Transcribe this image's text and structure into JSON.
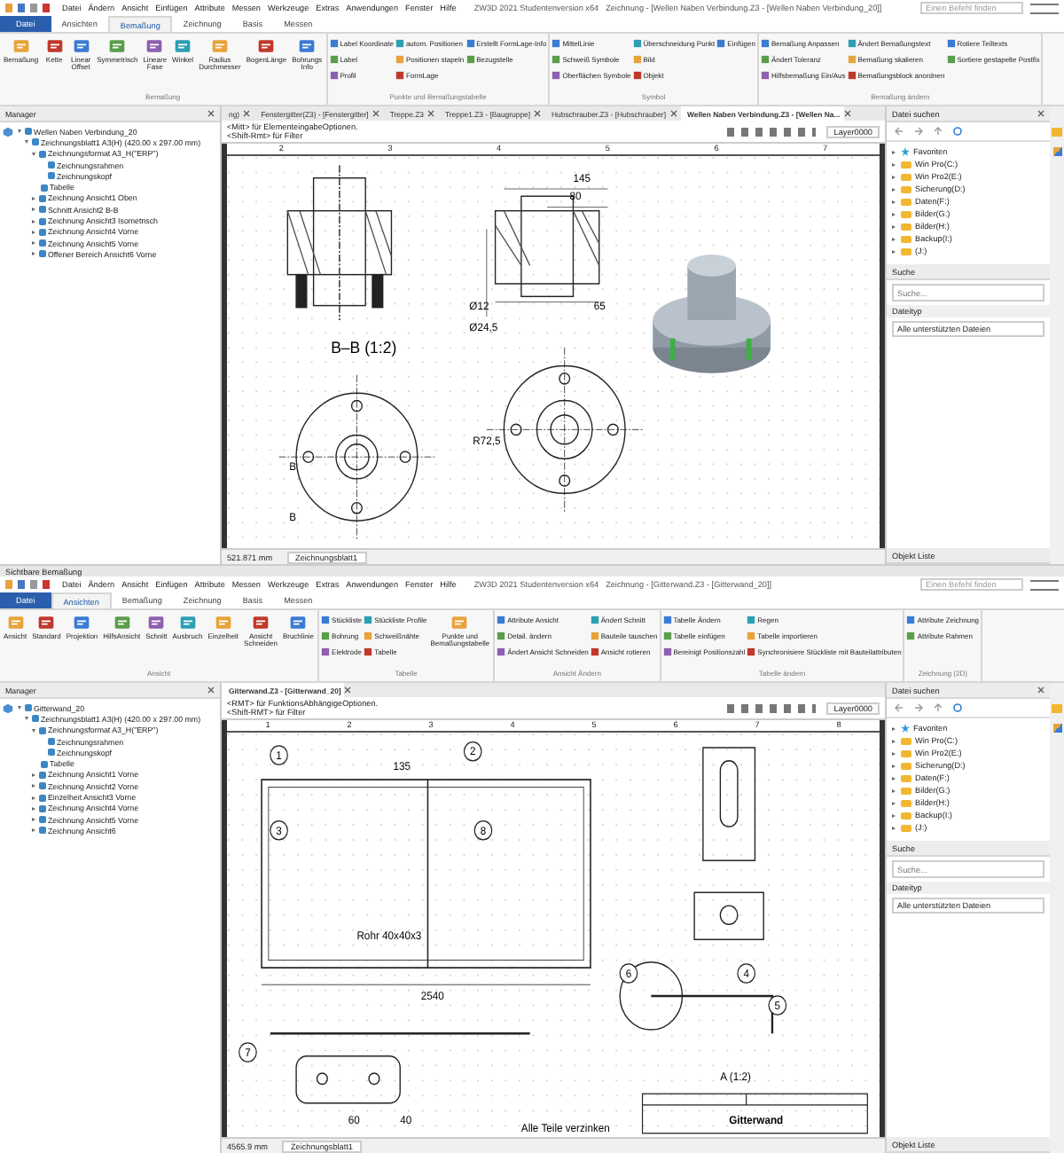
{
  "windows": [
    {
      "quick_menu": [
        "Datei",
        "Ändern",
        "Ansicht",
        "Einfügen",
        "Attribute",
        "Messen",
        "Werkzeuge",
        "Extras",
        "Anwendungen",
        "Fenster",
        "Hilfe"
      ],
      "app_title": "ZW3D  2021 Studentenversion x64",
      "doc_title": "Zeichnung - [Wellen Naben Verbindung.Z3 - [Wellen Naben Verbindung_20]]",
      "command_search": {
        "placeholder": "Einen Befehl finden"
      },
      "ribbon_tabs": [
        {
          "label": "Datei",
          "kind": "file",
          "selected": false
        },
        {
          "label": "Ansichten",
          "kind": "tab",
          "selected": false
        },
        {
          "label": "Bemaßung",
          "kind": "tab",
          "selected": true
        },
        {
          "label": "Zeichnung",
          "kind": "tab",
          "selected": false
        },
        {
          "label": "Basis",
          "kind": "tab",
          "selected": false
        },
        {
          "label": "Messen",
          "kind": "tab",
          "selected": false
        }
      ],
      "ribbon_groups": [
        {
          "title": "Bemaßung",
          "items": [
            {
              "label": "Bemaßung",
              "kind": "large"
            },
            {
              "label": "Kette",
              "kind": "large"
            },
            {
              "label": "Linear Offset",
              "kind": "large"
            },
            {
              "label": "Symmetrisch",
              "kind": "large"
            },
            {
              "label": "Lineare Fase",
              "kind": "large"
            },
            {
              "label": "Winkel",
              "kind": "large"
            },
            {
              "label": "Radius Durchmesser",
              "kind": "large"
            },
            {
              "label": "BogenLänge",
              "kind": "large"
            },
            {
              "label": "Bohrungs Info",
              "kind": "large"
            }
          ]
        },
        {
          "title": "Punkte und Bemaßungstabelle",
          "items": [
            {
              "label": "Label Koordinate",
              "kind": "small"
            },
            {
              "label": "Label",
              "kind": "small"
            },
            {
              "label": "Profil",
              "kind": "small"
            },
            {
              "label": "autom. Positionen",
              "kind": "small"
            },
            {
              "label": "Positionen stapeln",
              "kind": "small"
            },
            {
              "label": "FormLage",
              "kind": "small"
            },
            {
              "label": "Erstellt FormLage-Info",
              "kind": "small"
            },
            {
              "label": "Bezugstelle",
              "kind": "small"
            }
          ]
        },
        {
          "title": "Symbol",
          "items": [
            {
              "label": "MittelLinie",
              "kind": "small"
            },
            {
              "label": "Schweiß Symbole",
              "kind": "small"
            },
            {
              "label": "Oberflächen Symbole",
              "kind": "small"
            },
            {
              "label": "Überschneidung Punkt",
              "kind": "small"
            },
            {
              "label": "Bild",
              "kind": "small"
            },
            {
              "label": "Objekt",
              "kind": "small"
            },
            {
              "label": "Einfügen",
              "kind": "small"
            }
          ]
        },
        {
          "title": "Bemaßung ändern",
          "items": [
            {
              "label": "Bemaßung Anpassen",
              "kind": "small"
            },
            {
              "label": "Ändert Toleranz",
              "kind": "small"
            },
            {
              "label": "Hilfsbemaßung Ein/Aus",
              "kind": "small"
            },
            {
              "label": "Ändert Bemaßungstext",
              "kind": "small"
            },
            {
              "label": "Bemaßung skalieren",
              "kind": "small"
            },
            {
              "label": "Bemaßungsblock anordnen",
              "kind": "small"
            },
            {
              "label": "Rotiere Teiltexts",
              "kind": "small"
            },
            {
              "label": "Sortiere gestapelte Postfix",
              "kind": "small"
            }
          ]
        }
      ],
      "manager": {
        "title": "Manager",
        "tree": [
          {
            "label": "Wellen Naben Verbindung_20",
            "children": [
              {
                "label": "Zeichnungsblatt1 A3(H) (420.00 x 297.00 mm)",
                "expanded": true,
                "children": [
                  {
                    "label": "Zeichnungsformat A3_H(\"ERP\")",
                    "expanded": true,
                    "children": [
                      {
                        "label": "Zeichnungsrahmen"
                      },
                      {
                        "label": "Zeichnungskopf"
                      }
                    ]
                  },
                  {
                    "label": "Tabelle"
                  },
                  {
                    "label": "Zeichnung Ansicht1 Oben",
                    "expanded": false
                  },
                  {
                    "label": "Schnitt Ansicht2 B-B",
                    "expanded": false
                  },
                  {
                    "label": "Zeichnung Ansicht3 Isometrisch",
                    "expanded": false
                  },
                  {
                    "label": "Zeichnung Ansicht4 Vorne",
                    "expanded": false
                  },
                  {
                    "label": "Zeichnung Ansicht5 Vorne",
                    "expanded": false
                  },
                  {
                    "label": "Offener Bereich Ansicht6 Vorne",
                    "expanded": false
                  }
                ]
              }
            ]
          }
        ]
      },
      "doc_tabs": [
        {
          "label": "ng)",
          "selected": false
        },
        {
          "label": "Fenstergitter(Z3) - [Fenstergitter]",
          "selected": false
        },
        {
          "label": "Treppe.Z3",
          "selected": false
        },
        {
          "label": "Treppe1.Z3 - [Baugruppe]",
          "selected": false
        },
        {
          "label": "Hubschrauber.Z3 - [Hubschrauber]",
          "selected": false
        },
        {
          "label": "Wellen Naben Verbindung.Z3 - [Wellen Na...",
          "selected": true
        }
      ],
      "hints": [
        "<Mitt> für ElementeingabeOptionen.",
        "<Shift-Rmt> für Filter"
      ],
      "layer": "Layer0000",
      "drawing": {
        "kind": "shaft_hub",
        "ruler": [
          "2",
          "3",
          "4",
          "5",
          "6",
          "7"
        ],
        "labels": [
          "B–B (1:2)",
          "145",
          "80",
          "Ø12",
          "65",
          "Ø24,5",
          "R72,5",
          "B",
          "B"
        ]
      },
      "status": "521.871 mm",
      "sheet_tab": "Zeichnungsblatt1",
      "file_panel": {
        "title": "Datei suchen",
        "items": [
          "Favoriten",
          "Win Pro(C:)",
          "Win Pro2(E:)",
          "Sicherung(D:)",
          "Daten(F:)",
          "Bilder(G:)",
          "Bilder(H:)",
          "Backup(I:)",
          "(J:)"
        ],
        "search_title": "Suche",
        "search": {
          "placeholder": "Suche..."
        },
        "filetype_title": "Dateityp",
        "filetype": "Alle unterstützten Dateien",
        "object_list": "Objekt Liste"
      }
    },
    {
      "quick_menu": [
        "Datei",
        "Ändern",
        "Ansicht",
        "Einfügen",
        "Attribute",
        "Messen",
        "Werkzeuge",
        "Extras",
        "Anwendungen",
        "Fenster",
        "Hilfe"
      ],
      "app_title": "ZW3D  2021 Studentenversion x64",
      "doc_title": "Zeichnung - [Gitterwand.Z3 - [Gitterwand_20]]",
      "command_search": {
        "placeholder": "Einen Befehl finden"
      },
      "ribbon_tabs": [
        {
          "label": "Datei",
          "kind": "file",
          "selected": false
        },
        {
          "label": "Ansichten",
          "kind": "tab",
          "selected": true
        },
        {
          "label": "Bemaßung",
          "kind": "tab",
          "selected": false
        },
        {
          "label": "Zeichnung",
          "kind": "tab",
          "selected": false
        },
        {
          "label": "Basis",
          "kind": "tab",
          "selected": false
        },
        {
          "label": "Messen",
          "kind": "tab",
          "selected": false
        }
      ],
      "ribbon_groups": [
        {
          "title": "Ansicht",
          "items": [
            {
              "label": "Ansicht",
              "kind": "large"
            },
            {
              "label": "Standard",
              "kind": "large"
            },
            {
              "label": "Projektion",
              "kind": "large"
            },
            {
              "label": "HilfsAnsicht",
              "kind": "large"
            },
            {
              "label": "Schnitt",
              "kind": "large"
            },
            {
              "label": "Ausbruch",
              "kind": "large"
            },
            {
              "label": "Einzelheit",
              "kind": "large"
            },
            {
              "label": "Ansicht Schneiden",
              "kind": "large"
            },
            {
              "label": "Bruchlinie",
              "kind": "large"
            }
          ]
        },
        {
          "title": "Tabelle",
          "items": [
            {
              "label": "Stückliste",
              "kind": "small"
            },
            {
              "label": "Bohrung",
              "kind": "small"
            },
            {
              "label": "Elektrode",
              "kind": "small"
            },
            {
              "label": "Stückliste Profile",
              "kind": "small"
            },
            {
              "label": "Schweißnähte",
              "kind": "small"
            },
            {
              "label": "Tabelle",
              "kind": "small"
            },
            {
              "label": "Punkte und Bemaßungstabelle",
              "kind": "large"
            }
          ]
        },
        {
          "title": "Ansicht Ändern",
          "items": [
            {
              "label": "Attribute Ansicht",
              "kind": "small"
            },
            {
              "label": "Detail. ändern",
              "kind": "small"
            },
            {
              "label": "Ändert Ansicht Schneiden",
              "kind": "small"
            },
            {
              "label": "Ändert Schnitt",
              "kind": "small"
            },
            {
              "label": "Bauteile tauschen",
              "kind": "small"
            },
            {
              "label": "Ansicht rotieren",
              "kind": "small"
            }
          ]
        },
        {
          "title": "Tabelle ändern",
          "items": [
            {
              "label": "Tabelle Ändern",
              "kind": "small"
            },
            {
              "label": "Tabelle einfügen",
              "kind": "small"
            },
            {
              "label": "Bereinigt Positionszahl",
              "kind": "small"
            },
            {
              "label": "Regen",
              "kind": "small"
            },
            {
              "label": "Tabelle importieren",
              "kind": "small"
            },
            {
              "label": "Synchronisiere Stückliste mit Bauteilattributen",
              "kind": "small"
            }
          ]
        },
        {
          "title": "Zeichnung (2D)",
          "items": [
            {
              "label": "Attribute Zeichnung",
              "kind": "small"
            },
            {
              "label": "Attribute Rahmen",
              "kind": "small"
            }
          ]
        }
      ],
      "manager": {
        "title": "Manager",
        "tree": [
          {
            "label": "Gitterwand_20",
            "children": [
              {
                "label": "Zeichnungsblatt1 A3(H) (420.00 x 297.00 mm)",
                "expanded": true,
                "children": [
                  {
                    "label": "Zeichnungsformat A3_H(\"ERP\")",
                    "expanded": true,
                    "children": [
                      {
                        "label": "Zeichnungsrahmen"
                      },
                      {
                        "label": "Zeichnungskopf"
                      }
                    ]
                  },
                  {
                    "label": "Tabelle"
                  },
                  {
                    "label": "Zeichnung Ansicht1 Vorne",
                    "expanded": false
                  },
                  {
                    "label": "Zeichnung Ansicht2 Vorne",
                    "expanded": false
                  },
                  {
                    "label": "Einzelheit Ansicht3 Vorne",
                    "expanded": false
                  },
                  {
                    "label": "Zeichnung Ansicht4 Vorne",
                    "expanded": false
                  },
                  {
                    "label": "Zeichnung Ansicht5 Vorne",
                    "expanded": false
                  },
                  {
                    "label": "Zeichnung Ansicht6",
                    "expanded": false
                  }
                ]
              }
            ]
          }
        ]
      },
      "doc_tabs": [
        {
          "label": "Gitterwand.Z3 - [Gitterwand_20]",
          "selected": true
        }
      ],
      "hints": [
        "<RMT> für FunktionsAbhängigeOptionen.",
        "<Shift-RMT> für Filter"
      ],
      "layer": "Layer0000",
      "drawing": {
        "kind": "grid_wall",
        "ruler": [
          "1",
          "2",
          "3",
          "4",
          "5",
          "6",
          "7",
          "8"
        ],
        "labels": [
          "Rohr 40x40x3",
          "2540",
          "135",
          "60",
          "40",
          "A (1:2)",
          "Alle Teile verzinken",
          "Gitterwand"
        ],
        "balloons": [
          "1",
          "2",
          "3",
          "4",
          "5",
          "6",
          "7",
          "8"
        ]
      },
      "status": "4565.9 mm",
      "sheet_tab": "Zeichnungsblatt1",
      "file_panel": {
        "title": "Datei suchen",
        "items": [
          "Favoriten",
          "Win Pro(C:)",
          "Win Pro2(E:)",
          "Sicherung(D:)",
          "Daten(F:)",
          "Bilder(G:)",
          "Bilder(H:)",
          "Backup(I:)",
          "(J:)"
        ],
        "search_title": "Suche",
        "search": {
          "placeholder": "Suche..."
        },
        "filetype_title": "Dateityp",
        "filetype": "Alle unterstützten Dateien",
        "object_list": "Objekt Liste"
      }
    }
  ],
  "separator": "Sichtbare Bemaßung"
}
